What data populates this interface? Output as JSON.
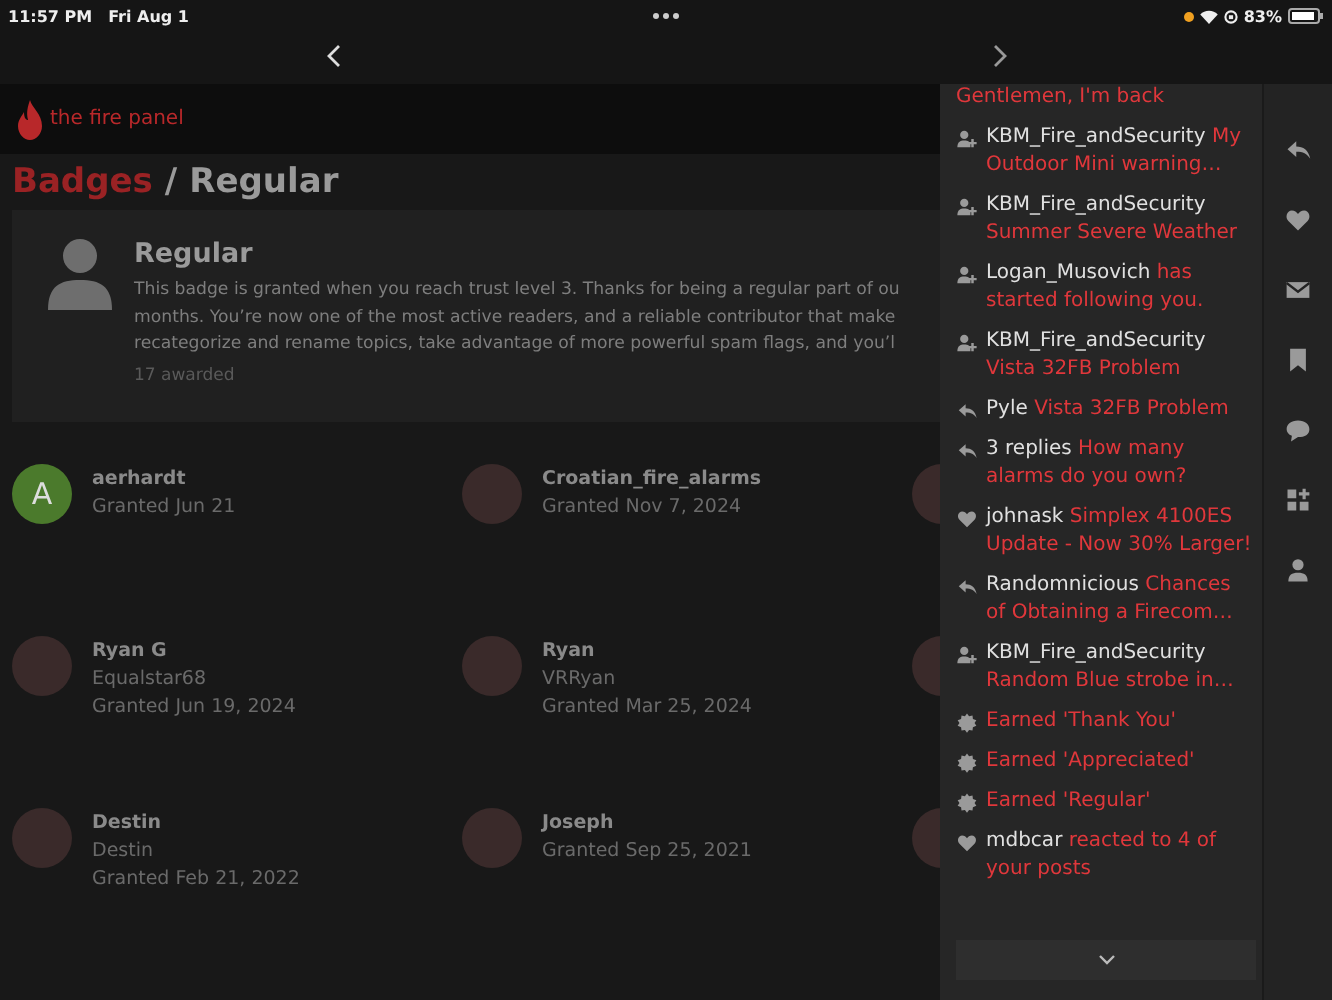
{
  "status_bar": {
    "time": "11:57 PM",
    "date": "Fri Aug 1",
    "battery": "83%"
  },
  "site": {
    "logo_text": "the fire panel"
  },
  "breadcrumb": {
    "parent": "Badges",
    "separator": "/",
    "current": "Regular"
  },
  "badge": {
    "title": "Regular",
    "description_lines": [
      "This badge is granted when you reach trust level 3. Thanks for being a regular part of ou",
      "months. You’re now one of the most active readers, and a reliable contributor that make",
      "recategorize and rename topics, take advantage of more powerful spam flags, and you’l"
    ],
    "awarded": "17 awarded"
  },
  "members": [
    {
      "name": "aerhardt",
      "kind": "letter",
      "letter": "A",
      "lines": [
        "Granted Jun 21"
      ]
    },
    {
      "name": "Croatian_fire_alarms",
      "kind": "photo",
      "lines": [
        "Granted Nov 7, 2024"
      ]
    },
    {
      "name": "Ryan G",
      "kind": "photo",
      "lines": [
        "Equalstar68",
        "Granted Jun 19, 2024"
      ]
    },
    {
      "name": "Ryan",
      "kind": "photo",
      "lines": [
        "VRRyan",
        "Granted Mar 25, 2024"
      ]
    },
    {
      "name": "Destin",
      "kind": "photo",
      "lines": [
        "Destin",
        "Granted Feb 21, 2022"
      ]
    },
    {
      "name": "Joseph",
      "kind": "photo",
      "lines": [
        "Granted Sep 25, 2021"
      ]
    }
  ],
  "notifications": [
    {
      "kind": "tail",
      "text": "Gentlemen, I'm back"
    },
    {
      "kind": "person",
      "user": "KBM_Fire_andSecurity",
      "text": "My Outdoor Mini warning…"
    },
    {
      "kind": "person",
      "user": "KBM_Fire_andSecurity",
      "text": "Summer Severe Weather"
    },
    {
      "kind": "person",
      "user": "Logan_Musovich",
      "text": "has started following you."
    },
    {
      "kind": "person",
      "user": "KBM_Fire_andSecurity",
      "text": "Vista 32FB Problem"
    },
    {
      "kind": "reply",
      "user": "Pyle",
      "text": "Vista 32FB Problem"
    },
    {
      "kind": "reply",
      "user": "3 replies",
      "text": "How many alarms do you own?"
    },
    {
      "kind": "heart",
      "user": "johnask",
      "text": "Simplex 4100ES Update - Now 30% Larger!"
    },
    {
      "kind": "reply",
      "user": "Randomnicious",
      "text": "Chances of Obtaining a Firecom…"
    },
    {
      "kind": "person",
      "user": "KBM_Fire_andSecurity",
      "text": "Random Blue strobe in…"
    },
    {
      "kind": "badge",
      "text": "Earned 'Thank You'"
    },
    {
      "kind": "badge",
      "text": "Earned 'Appreciated'"
    },
    {
      "kind": "badge",
      "text": "Earned 'Regular'"
    },
    {
      "kind": "heart",
      "user": "mdbcar",
      "text": "reacted to 4 of your posts"
    }
  ],
  "rail": [
    {
      "kind": "reply"
    },
    {
      "kind": "heart"
    },
    {
      "kind": "mail"
    },
    {
      "kind": "bookmark"
    },
    {
      "kind": "chat"
    },
    {
      "kind": "apps"
    },
    {
      "kind": "profile"
    }
  ]
}
